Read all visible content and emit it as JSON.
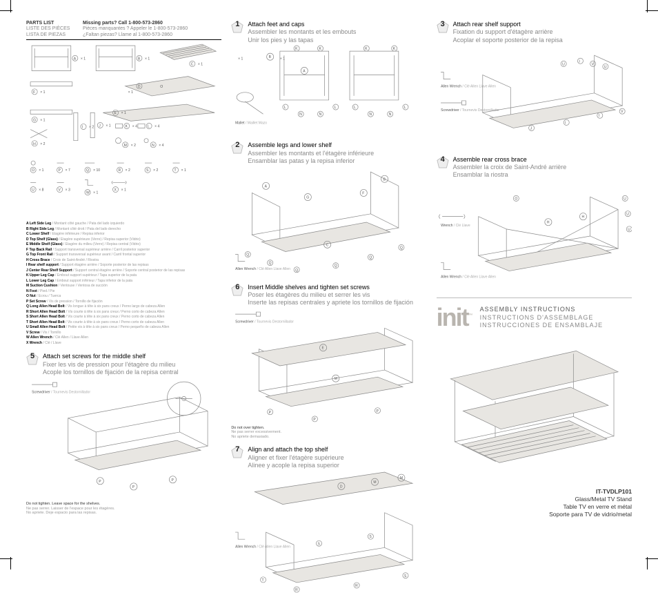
{
  "parts_list": {
    "heading": "PARTS LIST",
    "heading_fr": "LISTE DES PIÈCES",
    "heading_es": "LISTA DE PIEZAS",
    "missing": "Missing parts? Call  1-800-573-2860",
    "missing_fr": "Pièces manquantes ?  Appeler le 1-800-573-2860",
    "missing_es": "¿Faltan piezas?  Llame al 1-800-573-2860"
  },
  "legend": [
    {
      "k": "A",
      "en": "Left Side Leg",
      "alt": "/ Montant côté gauche / Pata del lado izquierdo"
    },
    {
      "k": "B",
      "en": "Right Side Leg",
      "alt": "/ Montant côté droit / Pata del lado derecho"
    },
    {
      "k": "C",
      "en": "Lower Shelf",
      "alt": "/ Étagère inférieure / Repisa inferior"
    },
    {
      "k": "D",
      "en": "Top Shelf (Glass)",
      "alt": "/ Étagère supérieure (Verre) / Repisa superior (Vidrio)"
    },
    {
      "k": "E",
      "en": "Middle Shelf (Glass)",
      "alt": "/ Étagère du milieu (Verre) / Repisa central (Vidrio)"
    },
    {
      "k": "F",
      "en": "Top Back Rail",
      "alt": "/ Support transversal supérieur arrière / Carril posterior superior"
    },
    {
      "k": "G",
      "en": "Top Front Rail",
      "alt": "/ Support transversal supérieur avant / Carril frontal superior"
    },
    {
      "k": "H",
      "en": "Cross Brace",
      "alt": "/ Croix de Saint-André / Riostra"
    },
    {
      "k": "I",
      "en": "Rear shelf support",
      "alt": "/ Support étagère arrière / Soporte posterior de las repisas"
    },
    {
      "k": "J",
      "en": "Center Rear Shelf Support",
      "alt": "/ Support central étagère arrière / Soporte central posterior de las repisas"
    },
    {
      "k": "K",
      "en": "Upper Leg Cap",
      "alt": "/ Embout support supérieur / Tapa superior de la pata"
    },
    {
      "k": "L",
      "en": "Lower Leg Cap",
      "alt": "/ Embout support inférieur / Tapa inferior de la pata"
    },
    {
      "k": "M",
      "en": "Suction Cushion",
      "alt": "/ Ventouse / Ventosa de succión"
    },
    {
      "k": "N",
      "en": "Foot",
      "alt": "/ Pied / Pie"
    },
    {
      "k": "O",
      "en": "Nut",
      "alt": "/ Écrou / Tuerca"
    },
    {
      "k": "P",
      "en": "Set Screw",
      "alt": "/ Vis de pression / Tornillo de fijación"
    },
    {
      "k": "Q",
      "en": "Long Allen Head Bolt",
      "alt": "/ Vis longue à tête à six pans creux / Perno largo de cabeza Allen"
    },
    {
      "k": "R",
      "en": "Short Allen Head Bolt",
      "alt": "/ Vis courte à tête à six pans creux / Perno corto de cabeza Allen"
    },
    {
      "k": "S",
      "en": "Short Allen Head Bolt",
      "alt": "/ Vis courte à tête à six pans creux / Perno corto de cabeza Allen"
    },
    {
      "k": "T",
      "en": "Short Allen Head Bolt",
      "alt": "/ Vis courte à tête à six pans creux / Perno corto de cabeza Allen"
    },
    {
      "k": "U",
      "en": "Small Allen Head Bolt",
      "alt": "/ Petite vis à tête à six pans creux / Perno pequeño de cabeza Allen"
    },
    {
      "k": "V",
      "en": "Screw",
      "alt": "/ Vis / Tornillo"
    },
    {
      "k": "W",
      "en": "Allen Wrench",
      "alt": "/ Clé Allen / Llave Allen"
    },
    {
      "k": "X",
      "en": "Wrench",
      "alt": "/ Clé / Llave"
    }
  ],
  "qty_labels": [
    "× 1",
    "× 1",
    "× 1",
    "× 1 O",
    "× 1",
    "× 1",
    "× 1",
    "× 2",
    "× 1",
    "× 4",
    "× 2",
    "× 2",
    "× 4",
    "× 1",
    "× 7",
    "× 10",
    "× 2",
    "× 2",
    "× 1",
    "× 8",
    "× 3",
    "× 1",
    "× 1"
  ],
  "steps": {
    "s1": {
      "num": "1",
      "en": "Attach feet and caps",
      "fr": "Assembler les montants et les embouts",
      "es": "Unir los pies y las tapas",
      "qty": "× 1",
      "tool_en": "Mallet",
      "tool_alt": "/ Maillet Mazo"
    },
    "s2": {
      "num": "2",
      "en": "Assemble legs and lower shelf",
      "fr": "Assembler les montants et l'étagère inférieure",
      "es": "Ensamblar las patas y la repisa inferior",
      "tool_en": "Allen Wrench",
      "tool_alt": "/ Clé Allen Llave Allen"
    },
    "s3": {
      "num": "3",
      "en": "Attach rear shelf support",
      "fr": "Fixation du support d'étagère arrière",
      "es": "Acoplar el soporte posterior de la repisa",
      "tool1_en": "Allen Wrench",
      "tool1_alt": "/ Clé Allen Llave Allen",
      "tool2_en": "Screwdriver",
      "tool2_alt": "/ Tournevis Destornillador"
    },
    "s4": {
      "num": "4",
      "en": "Assemble rear cross brace",
      "fr": "Assembler la croix de Saint-André arrière",
      "es": "Ensamblar la riostra",
      "tool1_en": "Wrench",
      "tool1_alt": "/ Clé Llave",
      "tool2_en": "Allen Wrench",
      "tool2_alt": "/ Clé Allen Llave Allen"
    },
    "s5": {
      "num": "5",
      "en": "Attach set screws for the middle shelf",
      "fr": "Fixer les vis de pression pour l'étagère du milieu",
      "es": "Acople los tornillos de fijación de la repisa central",
      "tool_en": "Screwdriver",
      "tool_alt": "/ Tournevis Destornillador",
      "note_en": "Do not tighten. Leave space for the shelves.",
      "note_fr": "Ne pas serrer. Laisser de l'espace pour les étagères.",
      "note_es": "No apriete. Deje espacio para las repisas."
    },
    "s6": {
      "num": "6",
      "en": "Insert Middle shelves and tighten set screws",
      "fr": "Poser les étagères du milieu et serrer les vis",
      "es": "Inserte las repisas centrales y apriete los tornillos de fijación",
      "tool_en": "Screwdriver",
      "tool_alt": "/ Tournevis Destornillador",
      "note_en": "Do not over tighten.",
      "note_fr": "Ne pas serrer excessivement.",
      "note_es": "No apriete demasiado."
    },
    "s7": {
      "num": "7",
      "en": "Align and attach the top shelf",
      "fr": "Aligner et fixer l'étagère supérieure",
      "es": "Alinee y acople la repisa superior",
      "tool_en": "Allen Wrench",
      "tool_alt": "/ Clé Allen Llave Allen"
    }
  },
  "brand": {
    "logo": "init",
    "tm": "™",
    "title_en": "ASSEMBLY INSTRUCTIONS",
    "title_fr": "INSTRUCTIONS D'ASSEMBLAGE",
    "title_es": "INSTRUCCIONES DE ENSAMBLAJE",
    "model": "IT-TVDLP101",
    "desc_en": "Glass/Metal TV Stand",
    "desc_fr": "Table TV en verre et métal",
    "desc_es": "Soporte para TV de vidrio/metal"
  }
}
